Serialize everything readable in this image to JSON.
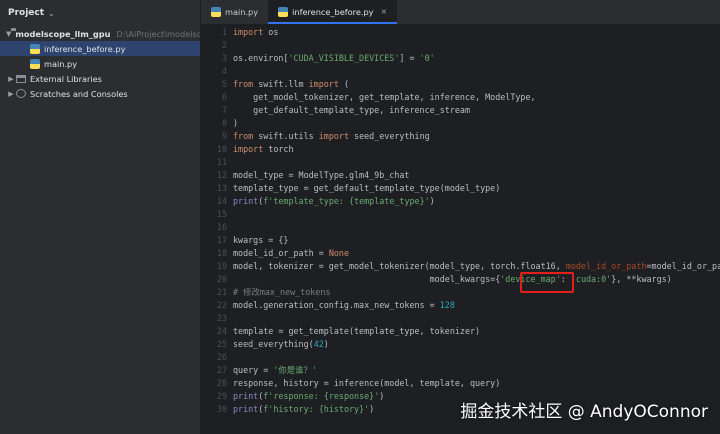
{
  "project": {
    "title": "Project",
    "root": {
      "name": "modelscope_llm_gpu",
      "path": "D:\\AIProject\\modelscope_"
    },
    "files": [
      "inference_before.py",
      "main.py"
    ],
    "others": [
      "External Libraries",
      "Scratches and Consoles"
    ]
  },
  "tabs": [
    {
      "label": "main.py"
    },
    {
      "label": "inference_before.py",
      "close": "×"
    }
  ],
  "code_lines": [
    "import os",
    "",
    "os.environ['CUDA_VISIBLE_DEVICES'] = '0'",
    "",
    "from swift.llm import (",
    "    get_model_tokenizer, get_template, inference, ModelType,",
    "    get_default_template_type, inference_stream",
    ")",
    "from swift.utils import seed_everything",
    "import torch",
    "",
    "model_type = ModelType.glm4_9b_chat",
    "template_type = get_default_template_type(model_type)",
    "print(f'template_type: {template_type}')",
    "",
    "",
    "kwargs = {}",
    "model_id_or_path = None",
    "model, tokenizer = get_model_tokenizer(model_type, torch.float16, model_id_or_path=model_id_or_path,",
    "                                       model_kwargs={'device_map': 'cuda:0'}, **kwargs)",
    "# 修改max_new_tokens",
    "model.generation_config.max_new_tokens = 128",
    "",
    "template = get_template(template_type, tokenizer)",
    "seed_everything(42)",
    "",
    "query = '你是谁？'",
    "response, history = inference(model, template, query)",
    "print(f'response: {response}')",
    "print(f'history: {history}')"
  ],
  "highlighted_text": "'cuda:0'",
  "watermark": "掘金技术社区 @ AndyOConnor",
  "colors": {
    "highlight_border": "#e3201b",
    "tab_accent": "#3574f0",
    "selection": "#2e436e"
  }
}
